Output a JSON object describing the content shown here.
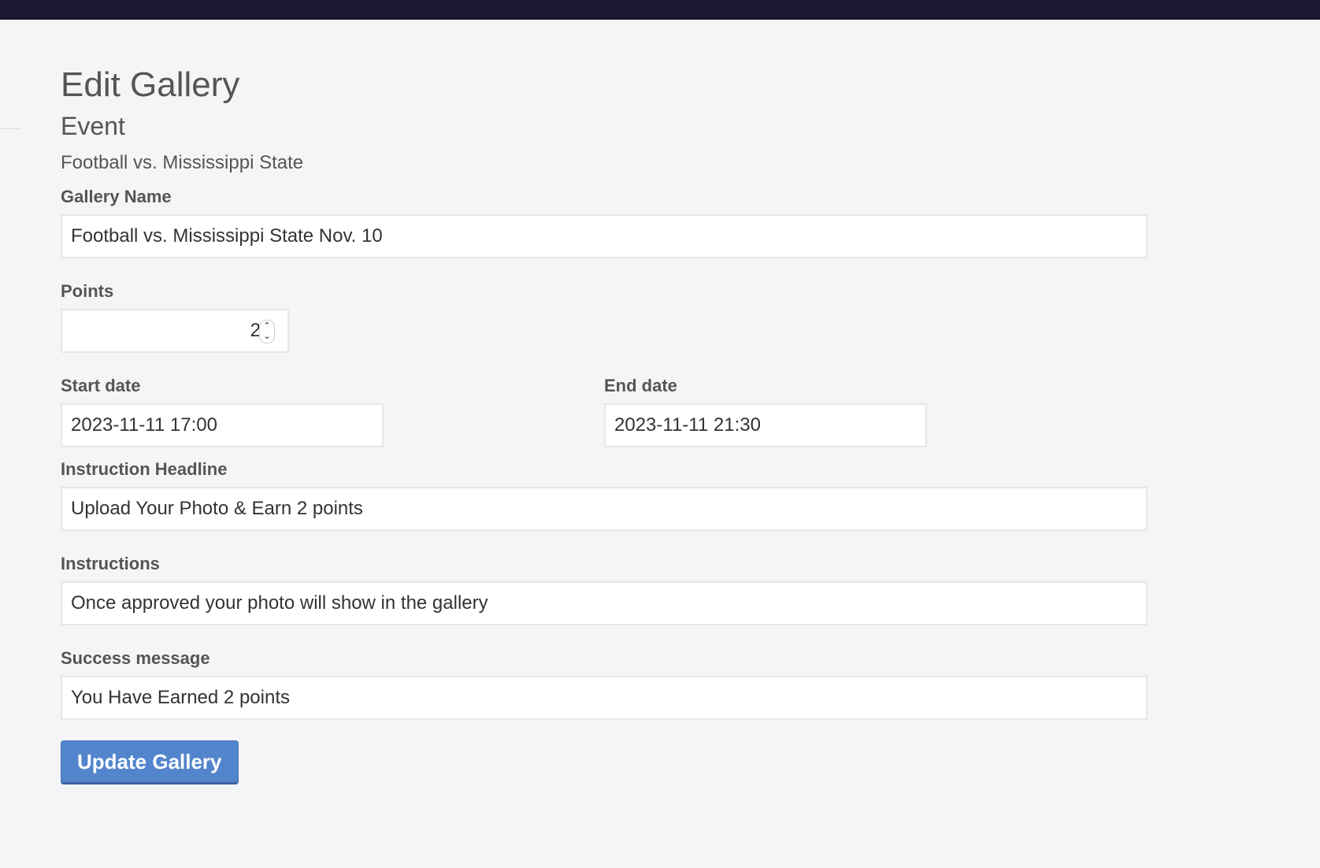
{
  "page": {
    "title": "Edit Gallery",
    "section_title": "Event",
    "event_name": "Football vs. Mississippi State"
  },
  "form": {
    "gallery_name": {
      "label": "Gallery Name",
      "value": "Football vs. Mississippi State Nov. 10"
    },
    "points": {
      "label": "Points",
      "value": "2"
    },
    "start_date": {
      "label": "Start date",
      "value": "2023-11-11 17:00"
    },
    "end_date": {
      "label": "End date",
      "value": "2023-11-11 21:30"
    },
    "instruction_headline": {
      "label": "Instruction Headline",
      "value": "Upload Your Photo & Earn 2 points"
    },
    "instructions": {
      "label": "Instructions",
      "value": "Once approved your photo will show in the gallery"
    },
    "success_message": {
      "label": "Success message",
      "value": "You Have Earned 2 points"
    },
    "submit_label": "Update Gallery"
  },
  "colors": {
    "topbar": "#1b1631",
    "background": "#f4f5f7",
    "button": "#5385cc"
  }
}
